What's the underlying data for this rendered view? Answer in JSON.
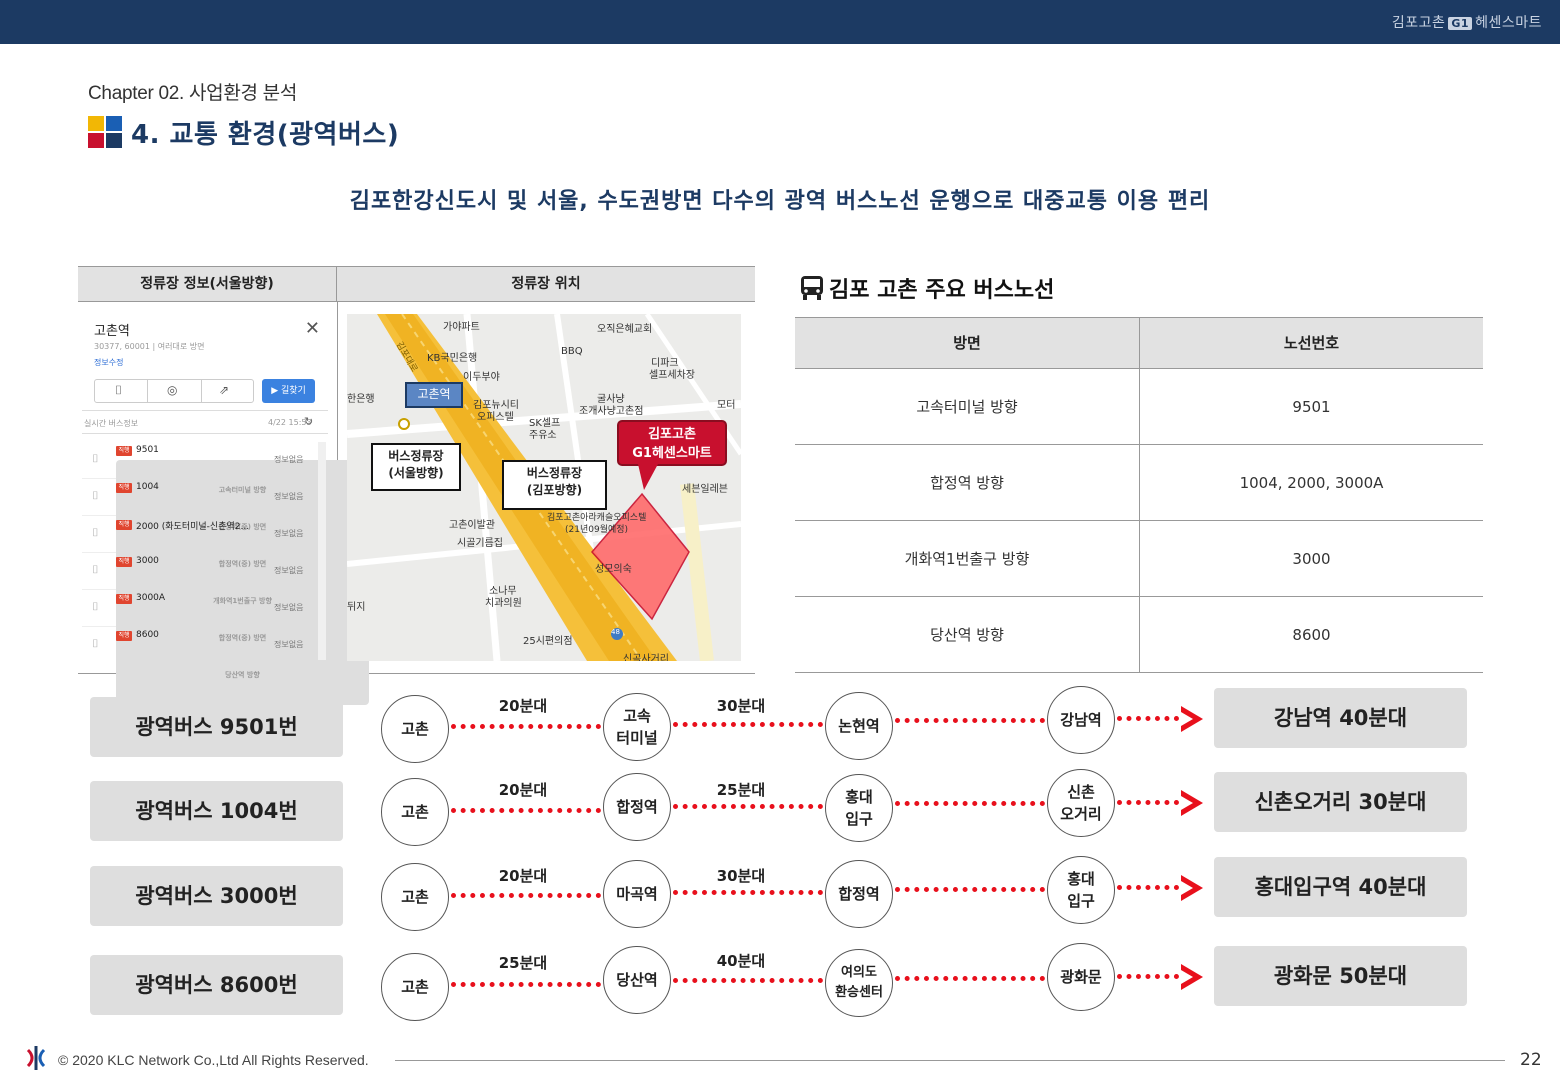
{
  "header": {
    "brand_prefix": "김포고촌",
    "brand_badge": "G1",
    "brand_suffix": "헤센스마트"
  },
  "chapter": "Chapter 02. 사업환경 분석",
  "section_title": "4. 교통 환경(광역버스)",
  "subtitle": "김포한강신도시 및 서울, 수도권방면 다수의 광역 버스노선 운행으로 대중교통 이용 편리",
  "left_table": {
    "col1": "정류장 정보(서울방향)",
    "col2": "정류장 위치"
  },
  "app": {
    "stop_name": "고촌역",
    "sub_text": "30377, 60001 | 여러대로 방면",
    "link": "정보수정",
    "route_button": "▶ 길찾기",
    "list_header": "실시간 버스정보",
    "list_time": "4/22 15:53",
    "rows": [
      {
        "badge": "직행",
        "number": "9501",
        "dest": "고속터미널 방향",
        "status": "정보없음"
      },
      {
        "badge": "직행",
        "number": "1004",
        "dest": "합정역(중) 방면",
        "status": "정보없음"
      },
      {
        "badge": "직행",
        "number": "2000 (화도터미널-신촌역2...",
        "dest": "합정역(중) 방면",
        "status": "정보없음"
      },
      {
        "badge": "직행",
        "number": "3000",
        "dest": "개화역1번출구 방향",
        "status": "정보없음"
      },
      {
        "badge": "직행",
        "number": "3000A",
        "dest": "합정역(중) 방면",
        "status": "정보없음"
      },
      {
        "badge": "직행",
        "number": "8600",
        "dest": "당산역 방향",
        "status": "정보없음"
      }
    ]
  },
  "map": {
    "station_label": "고촌역",
    "stop_seoul": [
      "버스정류장",
      "(서울방향)"
    ],
    "stop_gimpo": [
      "버스정류장",
      "(김포방향)"
    ],
    "callout": [
      "김포고촌",
      "G1헤센스마트"
    ],
    "labels": [
      "가야파트",
      "오직은혜교회",
      "KB국민은행",
      "BBQ",
      "이두부야",
      "디파크",
      "셀프세차장",
      "한은행",
      "굴사냥",
      "조개사냥고촌점",
      "김포뉴시티",
      "오피스텔",
      "SK셀프",
      "주유소",
      "모터",
      "세븐일레븐",
      "고촌이발관",
      "시골기름집",
      "김포고촌아라캐슬오피스텔",
      "(21년09월예정)",
      "성모의숙",
      "소나무",
      "치과의원",
      "25시편의점",
      "신곡사거리",
      "뒤지",
      "김포대로",
      "48"
    ]
  },
  "bus_section": {
    "title": "김포 고촌 주요 버스노선"
  },
  "routes_table": {
    "headers": [
      "방면",
      "노선번호"
    ],
    "rows": [
      [
        "고속터미널 방향",
        "9501"
      ],
      [
        "합정역 방향",
        "1004, 2000, 3000A"
      ],
      [
        "개화역1번출구 방향",
        "3000"
      ],
      [
        "당산역 방향",
        "8600"
      ]
    ]
  },
  "bus_routes": [
    {
      "name": "광역버스 9501번",
      "start": "고촌",
      "stop1": [
        "고속",
        "터미널"
      ],
      "stop2": [
        "논현역"
      ],
      "stop3": [
        "강남역"
      ],
      "time1": "20분대",
      "time2": "30분대",
      "destination": "강남역 40분대"
    },
    {
      "name": "광역버스 1004번",
      "start": "고촌",
      "stop1": [
        "합정역"
      ],
      "stop2": [
        "홍대",
        "입구"
      ],
      "stop3": [
        "신촌",
        "오거리"
      ],
      "time1": "20분대",
      "time2": "25분대",
      "destination": "신촌오거리 30분대"
    },
    {
      "name": "광역버스 3000번",
      "start": "고촌",
      "stop1": [
        "마곡역"
      ],
      "stop2": [
        "합정역"
      ],
      "stop3": [
        "홍대",
        "입구"
      ],
      "time1": "20분대",
      "time2": "30분대",
      "destination": "홍대입구역 40분대"
    },
    {
      "name": "광역버스 8600번",
      "start": "고촌",
      "stop1": [
        "당산역"
      ],
      "stop2": [
        "여의도",
        "환승센터"
      ],
      "stop3": [
        "광화문"
      ],
      "time1": "25분대",
      "time2": "40분대",
      "destination": "광화문 50분대"
    }
  ],
  "footer": {
    "copyright": "© 2020 KLC Network Co.,Ltd   All Rights Reserved.",
    "page": "22"
  },
  "colors": {
    "navy": "#1c3a63",
    "red": "#e8101c",
    "gray_box": "#dedede"
  }
}
